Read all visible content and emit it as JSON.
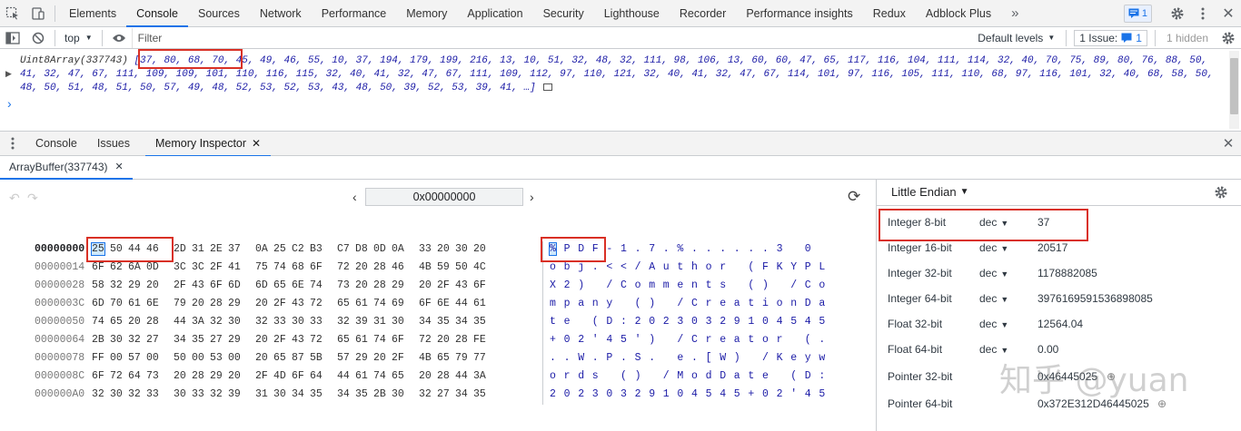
{
  "toolbar": {
    "tabs": [
      "Elements",
      "Console",
      "Sources",
      "Network",
      "Performance",
      "Memory",
      "Application",
      "Security",
      "Lighthouse",
      "Recorder",
      "Performance insights",
      "Redux",
      "Adblock Plus"
    ],
    "active_tab": "Console",
    "more": "»",
    "message_count": "1"
  },
  "filterbar": {
    "context": "top",
    "filter_placeholder": "Filter",
    "levels": "Default levels",
    "issues": "1 Issue:",
    "issues_count": "1",
    "hidden": "1 hidden"
  },
  "console": {
    "class_name": "Uint8Array(337743)",
    "values": "[37, 80, 68, 70, 45, 49, 46, 55, 10, 37, 194, 179, 199, 216, 13, 10, 51, 32, 48, 32, 111, 98, 106, 13, 60, 60, 47, 65, 117, 116, 104, 111, 114, 32, 40, 70, 75, 89, 80, 76, 88, 50, 41, 32, 47, 67, 111, 109, 109, 101, 110, 116, 115, 32, 40, 41, 32, 47, 67, 111, 109, 112, 97, 110, 121, 32, 40, 41, 32, 47, 67, 114, 101, 97, 116, 105, 111, 110, 68, 97, 116, 101, 32, 40, 68, 58, 50, 48, 50, 51, 48, 51, 50, 57, 49, 48, 52, 53, 52, 53, 43, 48, 50, 39, 52, 53, 39, 41, …]",
    "prompt": "›"
  },
  "drawer": {
    "tabs": [
      "Console",
      "Issues",
      "Memory Inspector"
    ],
    "active": "Memory Inspector"
  },
  "inspector": {
    "buffer_tab": "ArrayBuffer(337743)",
    "address": "0x00000000",
    "rows": [
      {
        "offset": "00000000",
        "bytes": [
          "25",
          "50",
          "44",
          "46",
          "2D",
          "31",
          "2E",
          "37",
          "0A",
          "25",
          "C2",
          "B3",
          "C7",
          "D8",
          "0D",
          "0A",
          "33",
          "20",
          "30",
          "20"
        ],
        "chars": [
          "%",
          "P",
          "D",
          "F",
          "-",
          "1",
          ".",
          "7",
          ".",
          "%",
          ".",
          ".",
          ".",
          ".",
          ".",
          ".",
          "3",
          " ",
          "0",
          " "
        ]
      },
      {
        "offset": "00000014",
        "bytes": [
          "6F",
          "62",
          "6A",
          "0D",
          "3C",
          "3C",
          "2F",
          "41",
          "75",
          "74",
          "68",
          "6F",
          "72",
          "20",
          "28",
          "46",
          "4B",
          "59",
          "50",
          "4C"
        ],
        "chars": [
          "o",
          "b",
          "j",
          ".",
          "<",
          "<",
          "/",
          "A",
          "u",
          "t",
          "h",
          "o",
          "r",
          " ",
          "(",
          "F",
          "K",
          "Y",
          "P",
          "L"
        ]
      },
      {
        "offset": "00000028",
        "bytes": [
          "58",
          "32",
          "29",
          "20",
          "2F",
          "43",
          "6F",
          "6D",
          "6D",
          "65",
          "6E",
          "74",
          "73",
          "20",
          "28",
          "29",
          "20",
          "2F",
          "43",
          "6F"
        ],
        "chars": [
          "X",
          "2",
          ")",
          " ",
          "/",
          "C",
          "o",
          "m",
          "m",
          "e",
          "n",
          "t",
          "s",
          " ",
          "(",
          ")",
          " ",
          "/",
          "C",
          "o"
        ]
      },
      {
        "offset": "0000003C",
        "bytes": [
          "6D",
          "70",
          "61",
          "6E",
          "79",
          "20",
          "28",
          "29",
          "20",
          "2F",
          "43",
          "72",
          "65",
          "61",
          "74",
          "69",
          "6F",
          "6E",
          "44",
          "61"
        ],
        "chars": [
          "m",
          "p",
          "a",
          "n",
          "y",
          " ",
          "(",
          ")",
          " ",
          "/",
          "C",
          "r",
          "e",
          "a",
          "t",
          "i",
          "o",
          "n",
          "D",
          "a"
        ]
      },
      {
        "offset": "00000050",
        "bytes": [
          "74",
          "65",
          "20",
          "28",
          "44",
          "3A",
          "32",
          "30",
          "32",
          "33",
          "30",
          "33",
          "32",
          "39",
          "31",
          "30",
          "34",
          "35",
          "34",
          "35"
        ],
        "chars": [
          "t",
          "e",
          " ",
          "(",
          "D",
          ":",
          "2",
          "0",
          "2",
          "3",
          "0",
          "3",
          "2",
          "9",
          "1",
          "0",
          "4",
          "5",
          "4",
          "5"
        ]
      },
      {
        "offset": "00000064",
        "bytes": [
          "2B",
          "30",
          "32",
          "27",
          "34",
          "35",
          "27",
          "29",
          "20",
          "2F",
          "43",
          "72",
          "65",
          "61",
          "74",
          "6F",
          "72",
          "20",
          "28",
          "FE"
        ],
        "chars": [
          "+",
          "0",
          "2",
          "'",
          "4",
          "5",
          "'",
          ")",
          " ",
          "/",
          "C",
          "r",
          "e",
          "a",
          "t",
          "o",
          "r",
          " ",
          "(",
          "."
        ]
      },
      {
        "offset": "00000078",
        "bytes": [
          "FF",
          "00",
          "57",
          "00",
          "50",
          "00",
          "53",
          "00",
          "20",
          "65",
          "87",
          "5B",
          "57",
          "29",
          "20",
          "2F",
          "4B",
          "65",
          "79",
          "77"
        ],
        "chars": [
          ".",
          ".",
          "W",
          ".",
          "P",
          ".",
          "S",
          ".",
          " ",
          "e",
          ".",
          "[",
          "W",
          ")",
          " ",
          "/",
          "K",
          "e",
          "y",
          "w"
        ]
      },
      {
        "offset": "0000008C",
        "bytes": [
          "6F",
          "72",
          "64",
          "73",
          "20",
          "28",
          "29",
          "20",
          "2F",
          "4D",
          "6F",
          "64",
          "44",
          "61",
          "74",
          "65",
          "20",
          "28",
          "44",
          "3A"
        ],
        "chars": [
          "o",
          "r",
          "d",
          "s",
          " ",
          "(",
          ")",
          " ",
          "/",
          "M",
          "o",
          "d",
          "D",
          "a",
          "t",
          "e",
          " ",
          "(",
          "D",
          ":"
        ]
      },
      {
        "offset": "000000A0",
        "bytes": [
          "32",
          "30",
          "32",
          "33",
          "30",
          "33",
          "32",
          "39",
          "31",
          "30",
          "34",
          "35",
          "34",
          "35",
          "2B",
          "30",
          "32",
          "27",
          "34",
          "35"
        ],
        "chars": [
          "2",
          "0",
          "2",
          "3",
          "0",
          "3",
          "2",
          "9",
          "1",
          "0",
          "4",
          "5",
          "4",
          "5",
          "+",
          "0",
          "2",
          "'",
          "4",
          "5"
        ]
      }
    ]
  },
  "values": {
    "endianness": "Little Endian",
    "rows": [
      {
        "name": "Integer 8-bit",
        "mode": "dec",
        "value": "37"
      },
      {
        "name": "Integer 16-bit",
        "mode": "dec",
        "value": "20517"
      },
      {
        "name": "Integer 32-bit",
        "mode": "dec",
        "value": "1178882085"
      },
      {
        "name": "Integer 64-bit",
        "mode": "dec",
        "value": "3976169591536898085"
      },
      {
        "name": "Float 32-bit",
        "mode": "dec",
        "value": "12564.04"
      },
      {
        "name": "Float 64-bit",
        "mode": "dec",
        "value": "0.00"
      },
      {
        "name": "Pointer 32-bit",
        "mode": "",
        "value": "0x46445025"
      },
      {
        "name": "Pointer 64-bit",
        "mode": "",
        "value": "0x372E312D46445025"
      }
    ]
  },
  "watermark": "知乎 @yuan"
}
